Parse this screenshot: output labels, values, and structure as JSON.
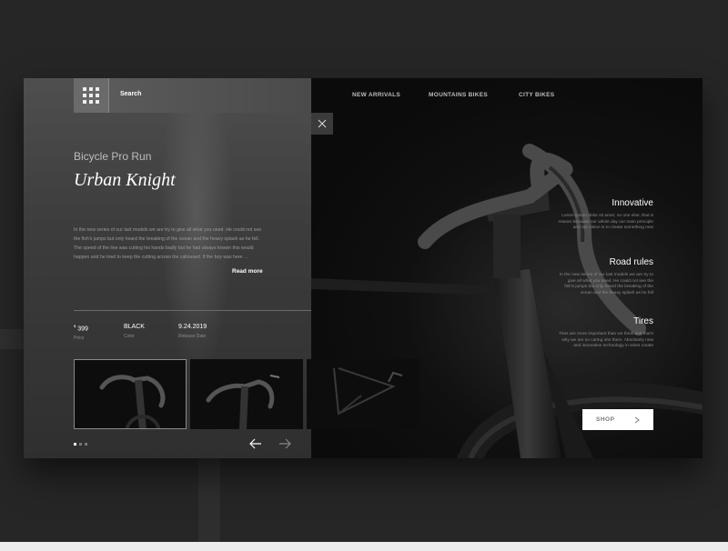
{
  "header": {
    "search_label": "Search",
    "nav": [
      "NEW ARRIVALS",
      "MOUNTAINS BIKES",
      "CITY BIKES"
    ]
  },
  "product": {
    "subtitle": "Bicycle Pro Run",
    "title": "Urban Knight",
    "description": "In the new series of our last models we are try to give all what you need. He could not see the fish's jumps but only heard the breaking of the ocean and the heavy splash as he fell. The speed of the line was cutting his hands badly but he had always known this would happen and he tried to keep the cutting across the calloused. If the boy was here ...",
    "read_more": "Read more",
    "specs": [
      {
        "currency": "$",
        "value": "399",
        "label": "Price"
      },
      {
        "value": "BLACK",
        "label": "Color"
      },
      {
        "value": "9.24.2019",
        "label": "Release Date"
      }
    ]
  },
  "features": [
    {
      "title": "Innovative",
      "text": "Lorem ipsum dolor sit amet, no one else, that is reason because our whole day our main principle and our vision is to create something new"
    },
    {
      "title": "Road rules",
      "text": "In the new series of our last models we are try to give all what you need. He could not see the fish's jumps but only heard the breaking of the ocean and the heavy splash as he fell"
    },
    {
      "title": "Tires",
      "text": "Tires are more important than we think and that's why we are so caring into them. Absolutely new and innovative technology in wires create"
    }
  ],
  "shop_label": "SHOP",
  "pager": {
    "total": 3,
    "active": 0
  },
  "colors": {
    "accent": "#ffffff",
    "card_left": "#3c3c3c",
    "card_right": "#101010",
    "page_bg": "#262626"
  }
}
